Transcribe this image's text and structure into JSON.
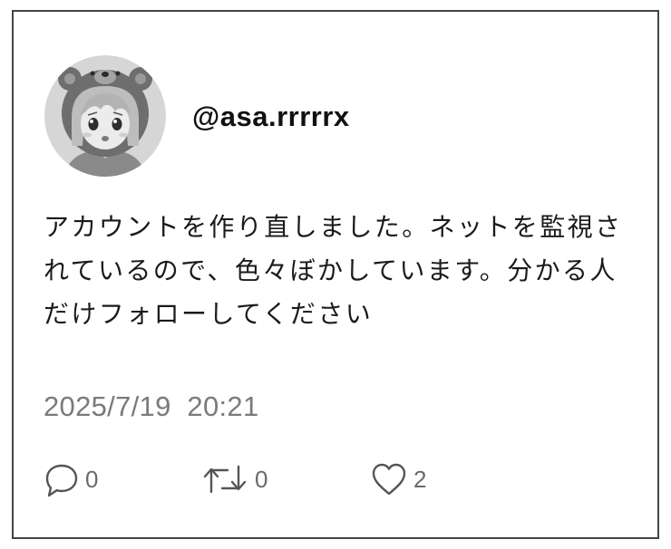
{
  "post": {
    "handle": "@asa.rrrrrx",
    "text": "アカウントを作り直しました。ネットを監視されているので、色々ぼかしています。分かる人だけフォローしてください",
    "timestamp": "2025/7/19  20:21",
    "actions": {
      "reply": {
        "icon": "comment-icon",
        "count": "0"
      },
      "retweet": {
        "icon": "retweet-icon",
        "count": "0"
      },
      "like": {
        "icon": "heart-icon",
        "count": "2"
      }
    }
  }
}
